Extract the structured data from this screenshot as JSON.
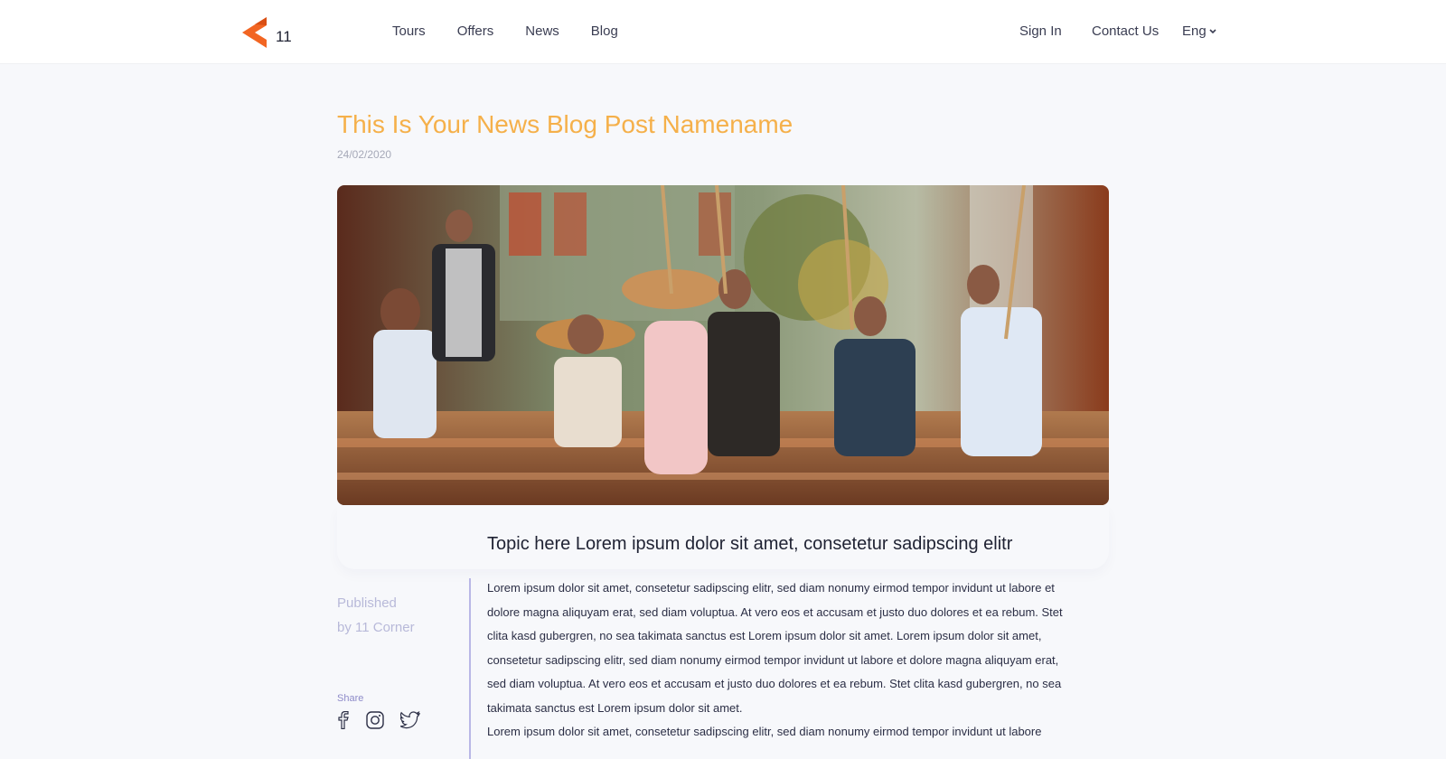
{
  "brand": {
    "name": "11",
    "logo_color": "#f26522"
  },
  "nav": {
    "items": [
      {
        "label": "Tours"
      },
      {
        "label": "Offers"
      },
      {
        "label": "News"
      },
      {
        "label": "Blog"
      }
    ],
    "sign_in": "Sign In",
    "contact": "Contact Us",
    "language": "Eng"
  },
  "post": {
    "title": "This Is Your News Blog Post Namename",
    "date": "24/02/2020",
    "topic": "Topic here Lorem ipsum dolor sit amet, consetetur sadipscing elitr",
    "published": "Published",
    "author": "by 11 Corner",
    "share_label": "Share",
    "paragraphs": [
      "Lorem ipsum dolor sit amet, consetetur sadipscing elitr, sed diam nonumy eirmod tempor invidunt ut labore et dolore magna aliquyam erat, sed diam voluptua. At vero eos et accusam et justo duo dolores et ea rebum. Stet clita kasd gubergren, no sea takimata sanctus est Lorem ipsum dolor sit amet. Lorem ipsum dolor sit amet, consetetur sadipscing elitr, sed diam nonumy eirmod tempor invidunt ut labore et dolore magna aliquyam erat, sed diam voluptua. At vero eos et accusam et justo duo dolores et ea rebum. Stet clita kasd gubergren, no sea takimata sanctus est Lorem ipsum dolor sit amet.",
      "Lorem ipsum dolor sit amet, consetetur sadipscing elitr, sed diam nonumy eirmod tempor invidunt ut labore"
    ]
  },
  "colors": {
    "title": "#f5b04a",
    "accent_purple": "#b9b7e6"
  },
  "icons": {
    "share": [
      "facebook-icon",
      "instagram-icon",
      "twitter-icon"
    ],
    "language_caret": "chevron-down-icon"
  }
}
